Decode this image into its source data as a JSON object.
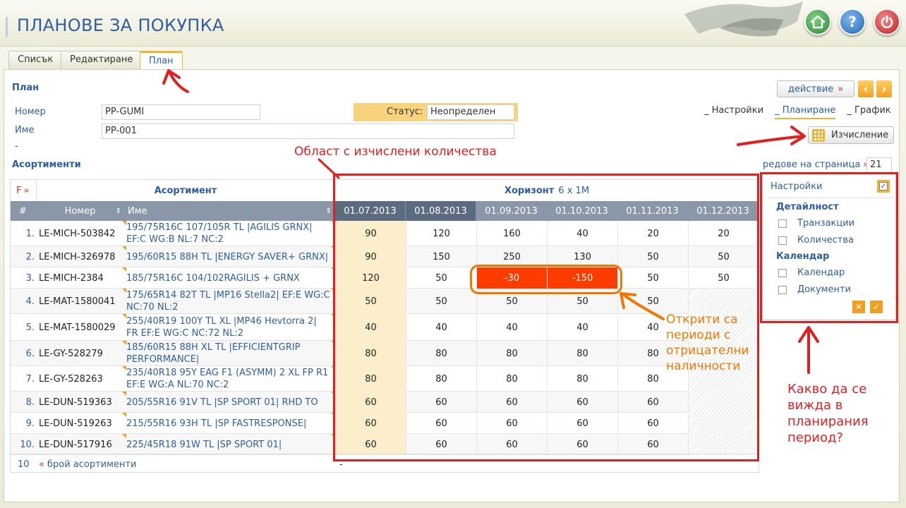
{
  "app": {
    "title": "ПЛАНОВЕ ЗА ПОКУПКА"
  },
  "tabs": [
    {
      "label": "Списък",
      "active": false
    },
    {
      "label": "Редактиране",
      "active": false
    },
    {
      "label": "План",
      "active": true
    }
  ],
  "form": {
    "section_title": "План",
    "number_label": "Номер",
    "number_value": "PP-GUMI",
    "name_label": "Име",
    "name_value": "PP-001",
    "dash": "-",
    "status_label": "Статус:",
    "status_value": "Неопределен"
  },
  "toolbar": {
    "action_label": "действие",
    "action_arrow": "»",
    "prev_icon": "‹",
    "next_icon": "›",
    "links": [
      "_ Настройки",
      "_ Планиране",
      "_ График"
    ],
    "calc_label": "Изчисление",
    "rows_per_page_label": "редове на страница",
    "rows_per_page_arrow": "»",
    "rows_per_page_value": "21"
  },
  "grid": {
    "section_title": "Асортименти",
    "filter_label": "F",
    "filter_arrow": "»",
    "assortment_header": "Асортимент",
    "horizon_label": "Хоризонт",
    "horizon_value": "6 x 1M",
    "columns": {
      "num": "#",
      "number": "Номер",
      "name": "Име"
    },
    "periods": [
      "01.07.2013",
      "01.08.2013",
      "01.09.2013",
      "01.10.2013",
      "01.11.2013",
      "01.12.2013"
    ],
    "rows": [
      {
        "idx": "1.",
        "number": "LE-MICH-503842",
        "name": "195/75R16C 107/105R TL |AGILIS GRNX| EF:C WG:B NL:7 NC:2",
        "values": [
          "90",
          "120",
          "160",
          "40",
          "20",
          "20"
        ]
      },
      {
        "idx": "2.",
        "number": "LE-MICH-326978",
        "name": "195/60R15 88H TL |ENERGY SAVER+ GRNX|",
        "values": [
          "90",
          "150",
          "250",
          "130",
          "50",
          "50"
        ]
      },
      {
        "idx": "3.",
        "number": "LE-MICH-2384",
        "name": "185/75R16C 104/102RAGILIS + GRNX",
        "values": [
          "120",
          "50",
          "-30",
          "-150",
          "50",
          "50"
        ]
      },
      {
        "idx": "4.",
        "number": "LE-MAT-1580041",
        "name": "175/65R14 82T TL |MP16 Stella2| EF:E WG:C NC:70 NL:2",
        "values": [
          "50",
          "50",
          "50",
          "50",
          "50",
          ""
        ]
      },
      {
        "idx": "5.",
        "number": "LE-MAT-1580029",
        "name": "255/40R19 100Y TL XL |MP46 Hevtorra 2| FR EF:E WG:C NC:72 NL:2",
        "values": [
          "40",
          "40",
          "40",
          "40",
          "40",
          ""
        ]
      },
      {
        "idx": "6.",
        "number": "LE-GY-528279",
        "name": "185/60R15 88H XL TL |EFFICIENTGRIP PERFORMANCE|",
        "values": [
          "80",
          "80",
          "80",
          "80",
          "80",
          ""
        ]
      },
      {
        "idx": "7.",
        "number": "LE-GY-528263",
        "name": "235/40R18 95Y EAG F1 (ASYMM) 2 XL FP R1 EF:E WG:A NL:70 NC:2",
        "values": [
          "80",
          "80",
          "80",
          "80",
          "80",
          ""
        ]
      },
      {
        "idx": "8.",
        "number": "LE-DUN-519363",
        "name": "205/55R16 91V TL |SP SPORT 01| RHD TO",
        "values": [
          "60",
          "60",
          "60",
          "60",
          "60",
          ""
        ]
      },
      {
        "idx": "9.",
        "number": "LE-DUN-519263",
        "name": "215/55R16 93H TL |SP FASTRESPONSE|",
        "values": [
          "60",
          "60",
          "60",
          "60",
          "60",
          ""
        ]
      },
      {
        "idx": "10.",
        "number": "LE-DUN-517916",
        "name": "225/45R18 91W TL |SP SPORT 01|",
        "values": [
          "60",
          "60",
          "60",
          "60",
          "60",
          ""
        ]
      }
    ],
    "footer_count": "10",
    "footer_arrow": "«",
    "footer_label": "брой асортименти",
    "footer_dash": "-"
  },
  "settings": {
    "title": "Настройки",
    "detail_heading": "Детайлност",
    "detail_options": [
      {
        "label": "Транзакции",
        "checked": false
      },
      {
        "label": "Количества",
        "checked": false
      }
    ],
    "calendar_heading": "Календар",
    "calendar_options": [
      {
        "label": "Календар",
        "checked": false
      },
      {
        "label": "Документи",
        "checked": false
      }
    ],
    "cancel_icon": "✕",
    "ok_icon": "✓"
  },
  "annotations": {
    "area_label": "Област с изчислени количества",
    "negative_note": [
      "Открити са",
      "периоди с",
      "отрицателни",
      "наличности"
    ],
    "question_note": [
      "Какво да се",
      "вижда в",
      "планирания",
      "период?"
    ]
  },
  "colors": {
    "accent": "#2f5e9e",
    "header_row": "#8a97a8",
    "period_header_active": "#5b6b80",
    "first_period_bg": "#fdeecb",
    "negative_bg": "#ff3c00",
    "annotation_red": "#e02020",
    "annotation_orange": "#f07800"
  }
}
